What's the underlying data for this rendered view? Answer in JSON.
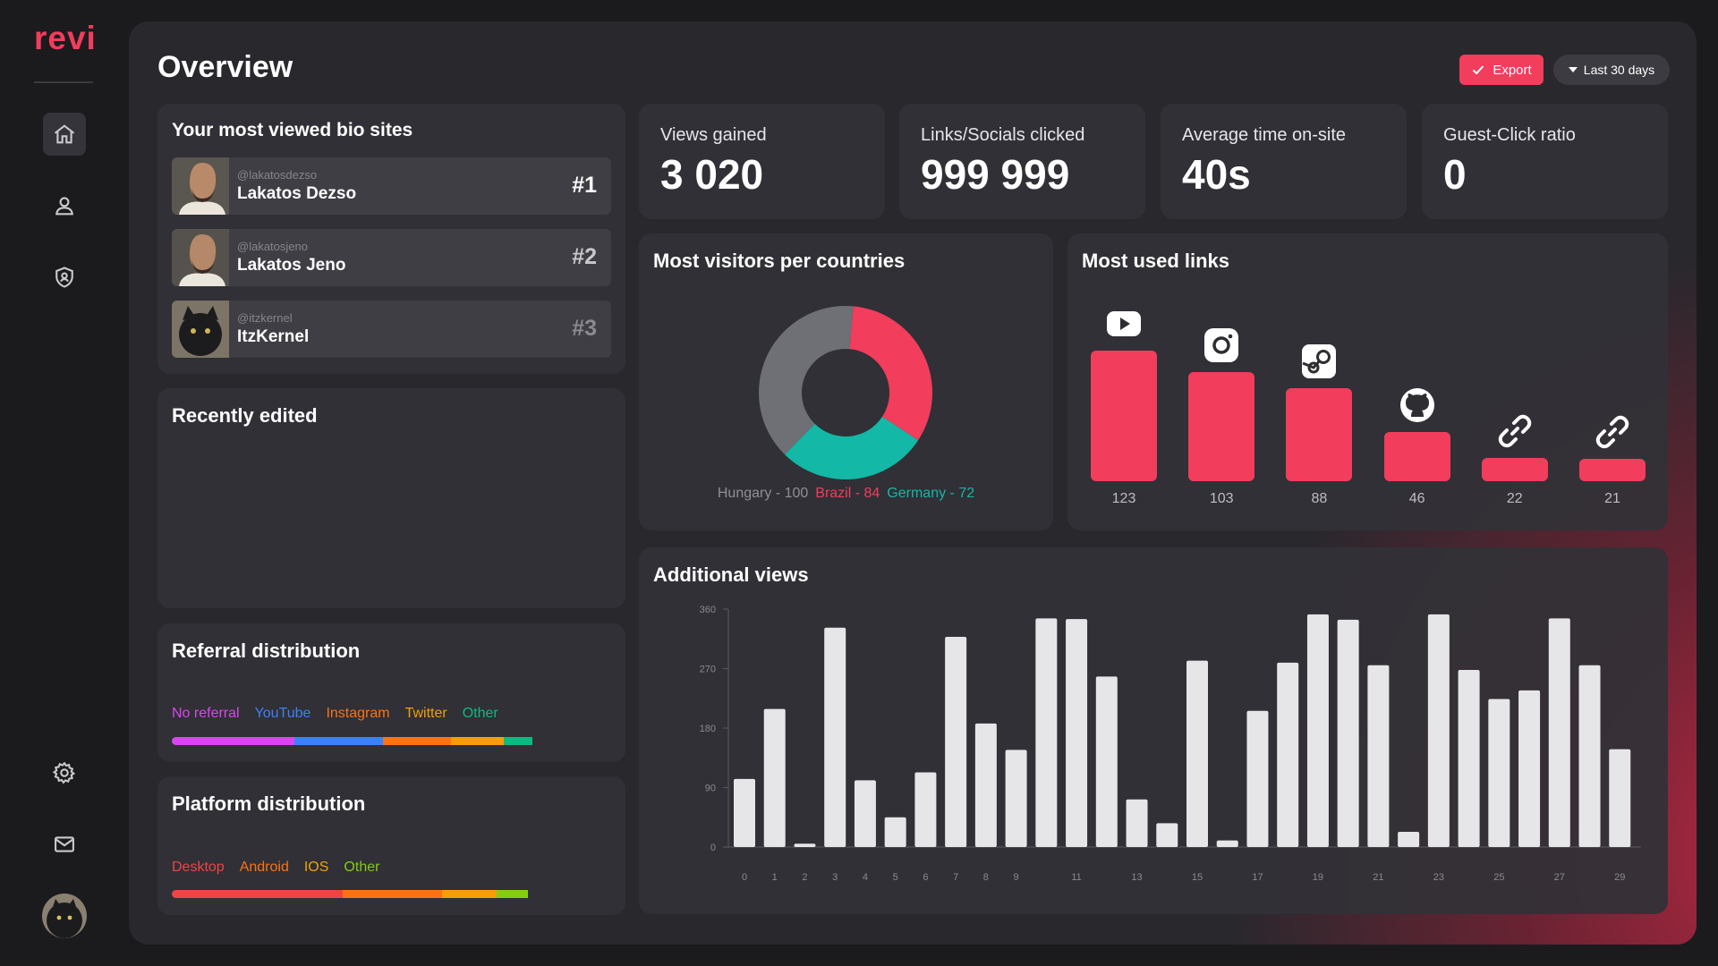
{
  "app": {
    "logo": "revi"
  },
  "header": {
    "title": "Overview",
    "export_label": "Export",
    "range_label": "Last 30 days"
  },
  "sidebar": {
    "items": [
      {
        "name": "home",
        "icon": "home-icon",
        "active": true
      },
      {
        "name": "profile",
        "icon": "user-icon"
      },
      {
        "name": "security",
        "icon": "shield-icon"
      },
      {
        "name": "settings",
        "icon": "gear-icon"
      },
      {
        "name": "messages",
        "icon": "mail-icon"
      }
    ]
  },
  "bio_sites": {
    "title": "Your most viewed bio sites",
    "items": [
      {
        "handle": "@lakatosdezso",
        "name": "Lakatos Dezso",
        "rank": "#1"
      },
      {
        "handle": "@lakatosjeno",
        "name": "Lakatos Jeno",
        "rank": "#2"
      },
      {
        "handle": "@itzkernel",
        "name": "ItzKernel",
        "rank": "#3"
      }
    ]
  },
  "recently_edited": {
    "title": "Recently edited"
  },
  "referral": {
    "title": "Referral distribution",
    "items": [
      {
        "label": "No referral",
        "color": "#d946ef",
        "share": 0.28
      },
      {
        "label": "YouTube",
        "color": "#3b82f6",
        "share": 0.2
      },
      {
        "label": "Instagram",
        "color": "#f97316",
        "share": 0.155
      },
      {
        "label": "Twitter",
        "color": "#f59e0b",
        "share": 0.12
      },
      {
        "label": "Other",
        "color": "#10b981",
        "share": 0.065
      }
    ]
  },
  "platform": {
    "title": "Platform distribution",
    "items": [
      {
        "label": "Desktop",
        "color": "#ef4444",
        "share": 0.39
      },
      {
        "label": "Android",
        "color": "#f97316",
        "share": 0.225
      },
      {
        "label": "IOS",
        "color": "#f59e0b",
        "share": 0.125
      },
      {
        "label": "Other",
        "color": "#84cc16",
        "share": 0.07
      }
    ]
  },
  "stats": [
    {
      "label": "Views gained",
      "value": "3 020"
    },
    {
      "label": "Links/Socials clicked",
      "value": "999 999"
    },
    {
      "label": "Average time on-site",
      "value": "40s"
    },
    {
      "label": "Guest-Click ratio",
      "value": "0"
    }
  ],
  "countries": {
    "title": "Most visitors per countries",
    "legend": [
      {
        "text": "Hungary - 100",
        "color": "#8f8f95"
      },
      {
        "text": "Brazil - 84",
        "color": "#f23d5c"
      },
      {
        "text": "Germany - 72",
        "color": "#14b8a6"
      }
    ]
  },
  "links": {
    "title": "Most used links",
    "items": [
      {
        "icon": "youtube-icon",
        "value": 123
      },
      {
        "icon": "instagram-icon",
        "value": 103
      },
      {
        "icon": "steam-icon",
        "value": 88
      },
      {
        "icon": "github-icon",
        "value": 46
      },
      {
        "icon": "link-icon",
        "value": 22
      },
      {
        "icon": "link-icon",
        "value": 21
      }
    ]
  },
  "chart_data": [
    {
      "type": "pie",
      "title": "Most visitors per countries",
      "labels": [
        "Hungary",
        "Brazil",
        "Germany"
      ],
      "values": [
        100,
        84,
        72
      ],
      "colors": [
        "#6f6f76",
        "#f23d5c",
        "#14b8a6"
      ]
    },
    {
      "type": "bar",
      "title": "Most used links",
      "categories": [
        "YouTube",
        "Instagram",
        "Steam",
        "GitHub",
        "Link",
        "Link"
      ],
      "values": [
        123,
        103,
        88,
        46,
        22,
        21
      ]
    },
    {
      "type": "bar",
      "title": "Additional views",
      "x": [
        0,
        1,
        2,
        3,
        4,
        5,
        6,
        7,
        8,
        9,
        10,
        11,
        12,
        13,
        14,
        15,
        16,
        17,
        18,
        19,
        20,
        21,
        22,
        23,
        24,
        25,
        26,
        27,
        28,
        29
      ],
      "x_tick_labels": [
        "0",
        "1",
        "2",
        "3",
        "4",
        "5",
        "6",
        "7",
        "8",
        "9",
        "11",
        "13",
        "15",
        "17",
        "19",
        "21",
        "23",
        "25",
        "27",
        "29"
      ],
      "values": [
        103,
        209,
        5,
        332,
        101,
        45,
        113,
        318,
        187,
        147,
        346,
        345,
        258,
        72,
        36,
        282,
        10,
        206,
        279,
        352,
        344,
        275,
        23,
        352,
        268,
        224,
        237,
        346,
        275,
        148
      ],
      "y_ticks": [
        "0",
        "90",
        "180",
        "270",
        "360"
      ],
      "ylim": [
        0,
        360
      ]
    }
  ]
}
